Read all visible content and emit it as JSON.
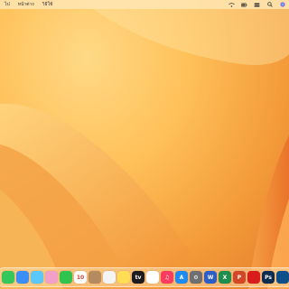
{
  "menubar": {
    "items": [
      "ไป",
      "หน้าต่าง",
      "วิธีใช้"
    ],
    "status_icons": [
      "wifi-icon",
      "battery-icon",
      "control-center-icon",
      "search-icon",
      "siri-icon"
    ]
  },
  "dock": {
    "apps": [
      {
        "name": "messages-icon",
        "glyph": "",
        "color": "#34c759"
      },
      {
        "name": "mail-icon",
        "glyph": "",
        "color": "#3a8ef6"
      },
      {
        "name": "maps-icon",
        "glyph": "",
        "color": "#5ac8fa"
      },
      {
        "name": "photos-icon",
        "glyph": "",
        "color": "#f2a0c8"
      },
      {
        "name": "facetime-icon",
        "glyph": "",
        "color": "#30c34e"
      },
      {
        "name": "calendar-icon",
        "glyph": "10",
        "color": "#ffffff"
      },
      {
        "name": "contacts-icon",
        "glyph": "",
        "color": "#b58a5e"
      },
      {
        "name": "reminders-icon",
        "glyph": "",
        "color": "#f4f4f4"
      },
      {
        "name": "notes-icon",
        "glyph": "",
        "color": "#ffdd55"
      },
      {
        "name": "tv-icon",
        "glyph": "tv",
        "color": "#1c1c1e"
      },
      {
        "name": "freeform-icon",
        "glyph": "",
        "color": "#ffffff"
      },
      {
        "name": "music-icon",
        "glyph": "♫",
        "color": "#fb3c5f"
      },
      {
        "name": "app-store-icon",
        "glyph": "A",
        "color": "#1d8bf1"
      },
      {
        "name": "system-settings-icon",
        "glyph": "⚙",
        "color": "#6e6e73"
      },
      {
        "name": "word-icon",
        "glyph": "W",
        "color": "#2b5ec7"
      },
      {
        "name": "excel-icon",
        "glyph": "X",
        "color": "#1f8d4c"
      },
      {
        "name": "powerpoint-icon",
        "glyph": "P",
        "color": "#d24726"
      },
      {
        "name": "acrobat-icon",
        "glyph": "",
        "color": "#d91d1d"
      },
      {
        "name": "photoshop-icon",
        "glyph": "Ps",
        "color": "#0b2c4f"
      },
      {
        "name": "app-overflow-icon",
        "glyph": "",
        "color": "#0d4f8b"
      }
    ]
  }
}
